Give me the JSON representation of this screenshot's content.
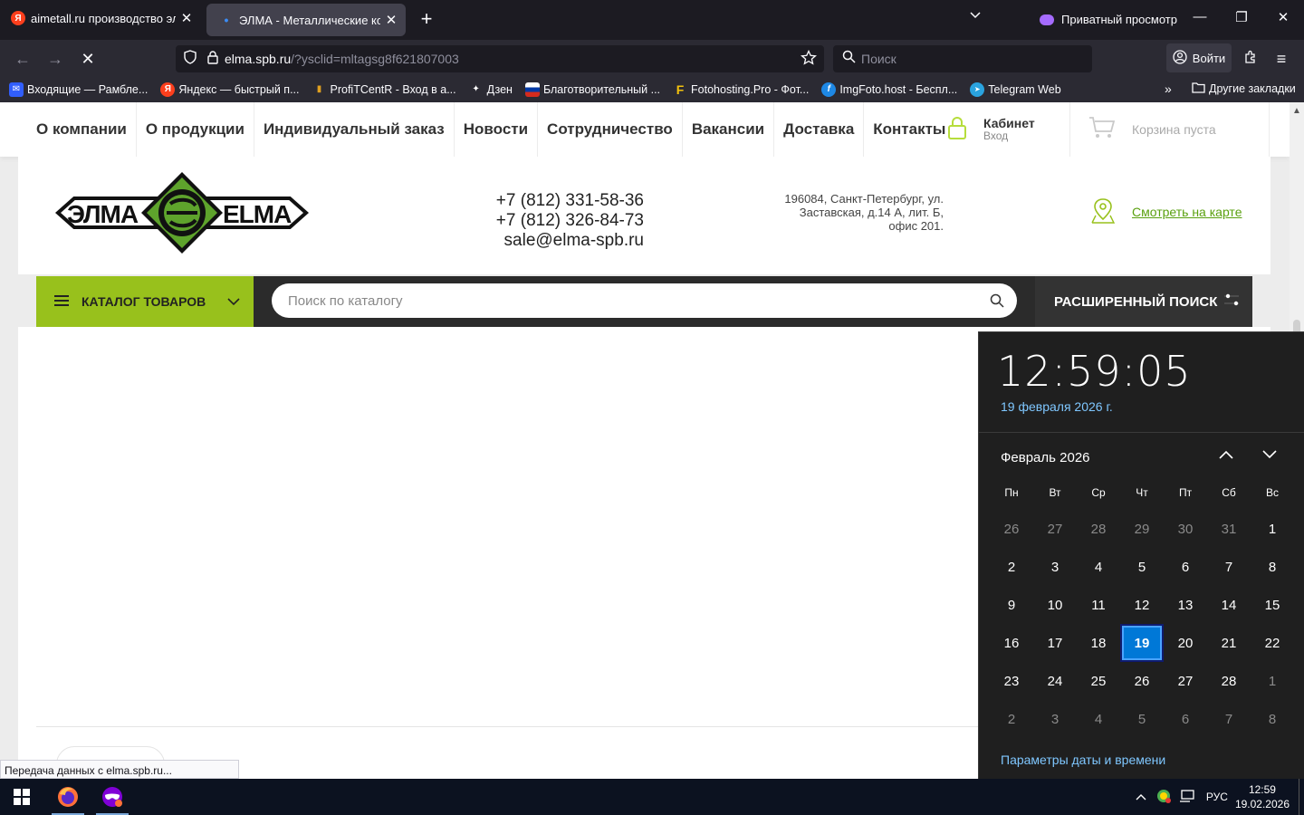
{
  "browser": {
    "tabs": [
      {
        "title": "aimetall.ru производство элект",
        "favicon": "Я"
      },
      {
        "title": "ЭЛМА - Металлические корпу",
        "favicon": "•"
      }
    ],
    "private_label": "Приватный просмотр",
    "url_host": "elma.spb.ru",
    "url_rest": "/?ysclid=mltagsg8f621807003",
    "search_placeholder": "Поиск",
    "signin_label": "Войти",
    "bookmarks": [
      {
        "label": "Входящие — Рамбле...",
        "color": "#315efb",
        "glyph": "✉"
      },
      {
        "label": "Яндекс — быстрый п...",
        "color": "#fc3f1d",
        "glyph": "Я"
      },
      {
        "label": "ProfiTCentR - Вход в а...",
        "color": "#e0a020",
        "glyph": "▮"
      },
      {
        "label": "Дзен",
        "color": "#2b2a33",
        "glyph": "✦"
      },
      {
        "label": "Благотворительный ...",
        "color": "#d52b1e",
        "glyph": "▬"
      },
      {
        "label": "Fotohosting.Pro - Фот...",
        "color": "#2b2a33",
        "glyph": "F"
      },
      {
        "label": "ImgFoto.host - Беспл...",
        "color": "#1e88e5",
        "glyph": "f"
      },
      {
        "label": "Telegram Web",
        "color": "#2aa3df",
        "glyph": "➤"
      }
    ],
    "other_bookmarks": "Другие закладки",
    "status_text": "Передача данных с elma.spb.ru..."
  },
  "site": {
    "nav": [
      "О компании",
      "О продукции",
      "Индивидуальный заказ",
      "Новости",
      "Сотрудничество",
      "Вакансии",
      "Доставка",
      "Контакты"
    ],
    "cabinet_title": "Кабинет",
    "cabinet_sub": "Вход",
    "cart_label": "Корзина пуста",
    "logo_left": "ЭЛМА",
    "logo_right": "ELMA",
    "phone1": "+7 (812) 331-58-36",
    "phone2": "+7 (812) 326-84-73",
    "email": "sale@elma-spb.ru",
    "address_line1": "196084, Санкт-Петербург, ул.",
    "address_line2": "Заставская, д.14 А, лит. Б,",
    "address_line3": "офис 201.",
    "map_link": "Смотреть на карте",
    "catalog_label": "КАТАЛОГ ТОВАРОВ",
    "catalog_search_placeholder": "Поиск по каталогу",
    "advanced_search": "РАСШИРЕННЫЙ ПОИСК",
    "accent_color": "#98c11c"
  },
  "calendar": {
    "time": "12:59:05",
    "date_long": "19 февраля 2026 г.",
    "month_label": "Февраль 2026",
    "weekdays": [
      "Пн",
      "Вт",
      "Ср",
      "Чт",
      "Пт",
      "Сб",
      "Вс"
    ],
    "weeks": [
      [
        "26",
        "27",
        "28",
        "29",
        "30",
        "31",
        "1"
      ],
      [
        "2",
        "3",
        "4",
        "5",
        "6",
        "7",
        "8"
      ],
      [
        "9",
        "10",
        "11",
        "12",
        "13",
        "14",
        "15"
      ],
      [
        "16",
        "17",
        "18",
        "19",
        "20",
        "21",
        "22"
      ],
      [
        "23",
        "24",
        "25",
        "26",
        "27",
        "28",
        "1"
      ],
      [
        "2",
        "3",
        "4",
        "5",
        "6",
        "7",
        "8"
      ]
    ],
    "today": "19",
    "settings_link": "Параметры даты и времени"
  },
  "taskbar": {
    "lang": "РУС",
    "time": "12:59",
    "date": "19.02.2026"
  }
}
